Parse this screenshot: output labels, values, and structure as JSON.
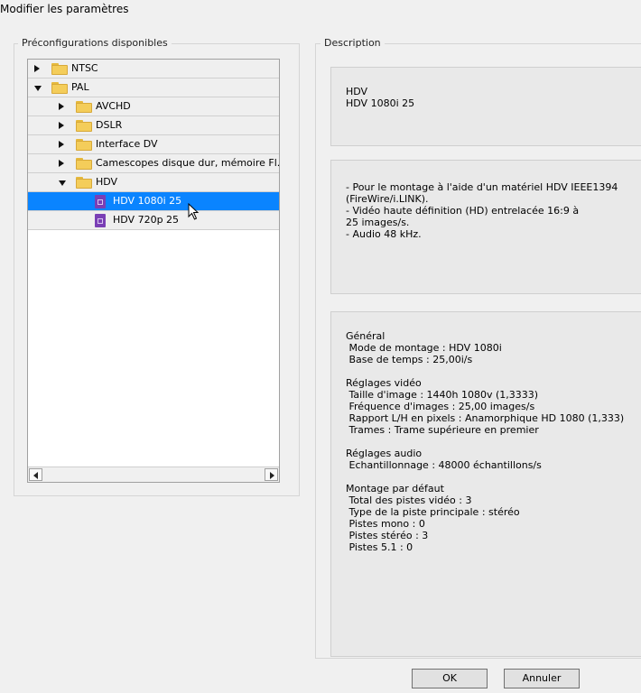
{
  "window": {
    "title": "Modifier les paramètres"
  },
  "presets_panel": {
    "legend": "Préconfigurations disponibles",
    "items": [
      {
        "label": "NTSC",
        "type": "folder",
        "state": "collapsed",
        "level": 0
      },
      {
        "label": "PAL",
        "type": "folder",
        "state": "expanded",
        "level": 0
      },
      {
        "label": "AVCHD",
        "type": "folder",
        "state": "collapsed",
        "level": 1
      },
      {
        "label": "DSLR",
        "type": "folder",
        "state": "collapsed",
        "level": 1
      },
      {
        "label": "Interface DV",
        "type": "folder",
        "state": "collapsed",
        "level": 1
      },
      {
        "label": "Camescopes disque dur, mémoire Fl.",
        "type": "folder",
        "state": "collapsed",
        "level": 1
      },
      {
        "label": "HDV",
        "type": "folder",
        "state": "expanded",
        "level": 1
      },
      {
        "label": "HDV 1080i 25",
        "type": "preset",
        "selected": true,
        "level": 2
      },
      {
        "label": "HDV 720p 25",
        "type": "preset",
        "selected": false,
        "level": 2
      }
    ]
  },
  "description_panel": {
    "legend": "Description",
    "summary": [
      "HDV",
      "HDV 1080i 25"
    ],
    "details": [
      "- Pour le montage à l'aide d'un matériel HDV IEEE1394",
      "(FireWire/i.LINK).",
      "- Vidéo haute définition (HD) entrelacée 16:9 à",
      "25 images/s.",
      "- Audio 48 kHz."
    ],
    "settings": [
      "Général",
      " Mode de montage : HDV 1080i",
      " Base de temps : 25,00i/s",
      "",
      "Réglages vidéo",
      " Taille d'image : 1440h 1080v (1,3333)",
      " Fréquence d'images : 25,00 images/s",
      " Rapport L/H en pixels : Anamorphique HD 1080 (1,333)",
      " Trames : Trame supérieure en premier",
      "",
      "Réglages audio",
      " Echantillonnage : 48000 échantillons/s",
      "",
      "Montage par défaut",
      " Total des pistes vidéo : 3",
      " Type de la piste principale : stéréo",
      " Pistes mono : 0",
      " Pistes stéréo : 3",
      " Pistes 5.1 : 0"
    ]
  },
  "buttons": {
    "ok": "OK",
    "cancel": "Annuler"
  },
  "colors": {
    "selection": "#0a84ff",
    "folder": "#f4cd5a",
    "preset_icon": "#7a3fb5"
  }
}
